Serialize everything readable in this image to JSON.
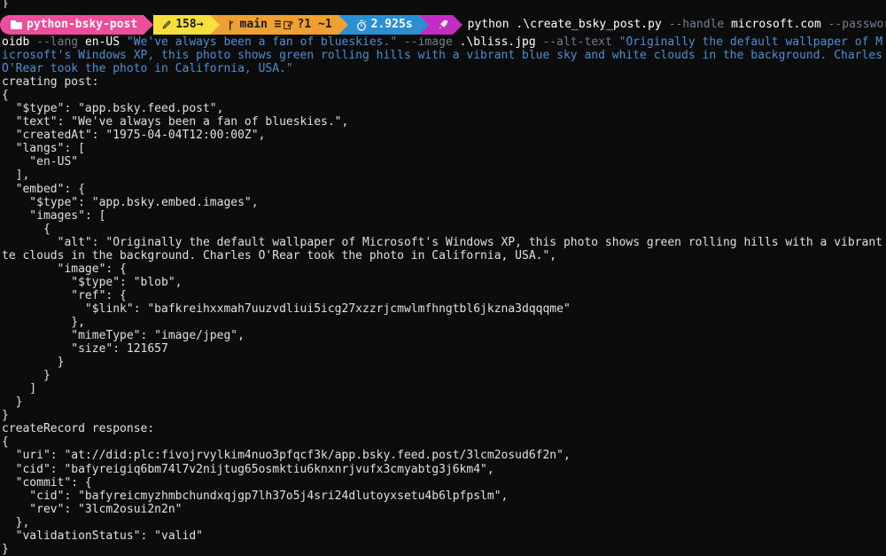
{
  "terminal": {
    "background": "#0c0c0c",
    "foreground": "#e8e8e8",
    "top_partial_line": "}",
    "prompt": {
      "directory": {
        "icon": "folder-icon",
        "label": "python-bsky-post",
        "bg": "#ee4d9b",
        "fg": "#ffffff"
      },
      "git_status": {
        "icon": "pencil-icon",
        "label": "158→",
        "bg": "#f5e03c",
        "fg": "#1a1a1a"
      },
      "branch": {
        "icon": "branch-icon",
        "label": "main ≡ ",
        "edit_icon": "edit-icon",
        "counts": "?1 ~1",
        "bg": "#f0a030",
        "fg": "#1a1a1a"
      },
      "duration": {
        "icon": "stopwatch-icon",
        "label": "2.925s",
        "bg": "#2b8fd4",
        "fg": "#ffffff"
      },
      "rocket": {
        "icon": "rocket-icon",
        "bg": "#c52bc5",
        "fg": "#ffffff"
      }
    },
    "command": {
      "program": "python",
      "script": ".\\create_bsky_post.py",
      "tokens": [
        {
          "type": "flag",
          "text": "--handle"
        },
        {
          "type": "arg",
          "text": "microsoft.com"
        },
        {
          "type": "flag",
          "text": "--password"
        },
        {
          "type": "arg",
          "text": "oidb"
        },
        {
          "type": "flag",
          "text": "--lang"
        },
        {
          "type": "arg",
          "text": "en-US"
        },
        {
          "type": "string",
          "text": "\"We've always been a fan of blueskies.\""
        },
        {
          "type": "flag",
          "text": "--image"
        },
        {
          "type": "arg",
          "text": ".\\bliss.jpg"
        },
        {
          "type": "flag",
          "text": "--alt-text"
        }
      ],
      "alt_text_string": "\"Originally the default wallpaper of Microsoft's Windows XP, this photo shows green rolling hills with a vibrant blue sky and white clouds in the background. Charles O'Rear took the photo in California, USA.\"",
      "colors": {
        "program": "#ffffff",
        "flag": "#6f7f93",
        "arg": "#ffffff",
        "string": "#4a8fd4"
      }
    },
    "output_lines": [
      "creating post:",
      "{",
      "  \"$type\": \"app.bsky.feed.post\",",
      "  \"text\": \"We've always been a fan of blueskies.\",",
      "  \"createdAt\": \"1975-04-04T12:00:00Z\",",
      "  \"langs\": [",
      "    \"en-US\"",
      "  ],",
      "  \"embed\": {",
      "    \"$type\": \"app.bsky.embed.images\",",
      "    \"images\": [",
      "      {",
      "        \"alt\": \"Originally the default wallpaper of Microsoft's Windows XP, this photo shows green rolling hills with a vibrant blue sky and whi",
      "te clouds in the background. Charles O'Rear took the photo in California, USA.\",",
      "        \"image\": {",
      "          \"$type\": \"blob\",",
      "          \"ref\": {",
      "            \"$link\": \"bafkreihxxmah7uuzvdliui5icg27xzzrjcmwlmfhngtbl6jkzna3dqqqme\"",
      "          },",
      "          \"mimeType\": \"image/jpeg\",",
      "          \"size\": 121657",
      "        }",
      "      }",
      "    ]",
      "  }",
      "}",
      "createRecord response:",
      "{",
      "  \"uri\": \"at://did:plc:fivojrvylkim4nuo3pfqcf3k/app.bsky.feed.post/3lcm2osud6f2n\",",
      "  \"cid\": \"bafyreigiq6bm74l7v2nijtug65osmktiu6knxnrjvufx3cmyabtg3j6km4\",",
      "  \"commit\": {",
      "    \"cid\": \"bafyreicmyzhmbchundxqjgp7lh37o5j4sri24dlutoyxsetu4b6lpfpslm\",",
      "    \"rev\": \"3lcm2osui2n2n\"",
      "  },",
      "  \"validationStatus\": \"valid\"",
      "}"
    ]
  }
}
